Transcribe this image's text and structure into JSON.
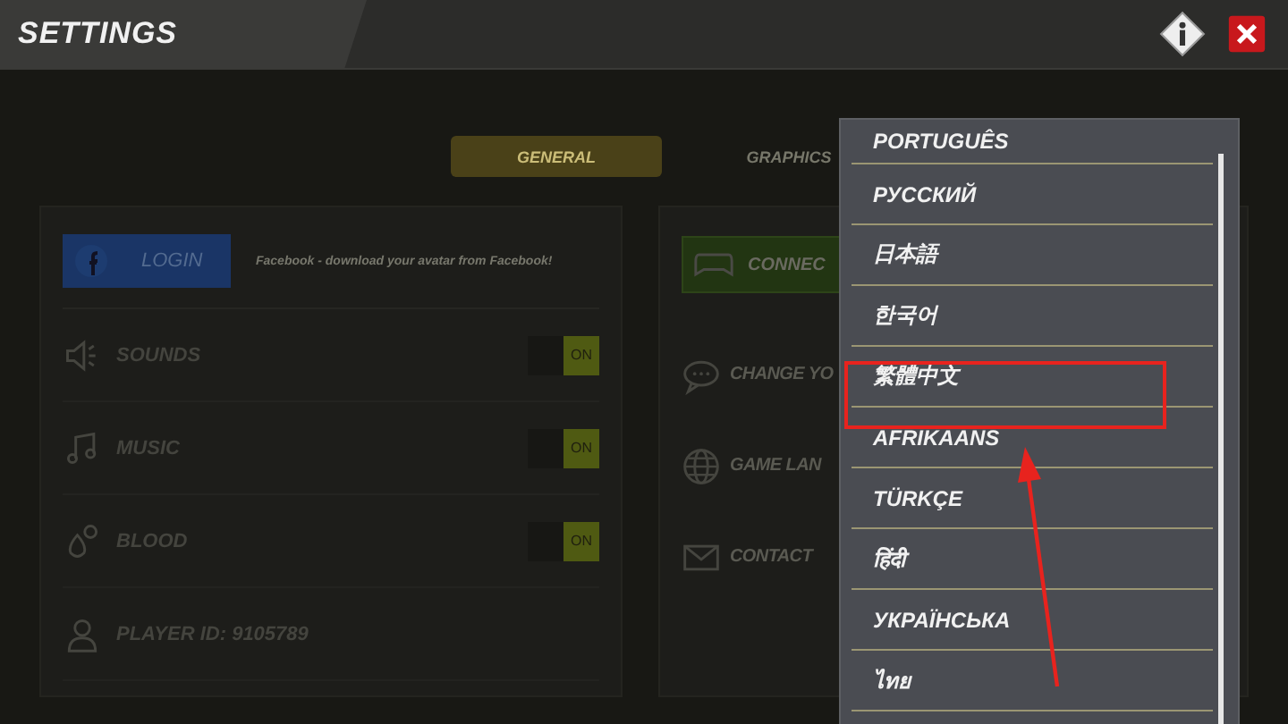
{
  "window": {
    "title": "SETTINGS"
  },
  "tabs": [
    {
      "label": "GENERAL",
      "selected": true
    },
    {
      "label": "GRAPHICS",
      "selected": false
    }
  ],
  "login": {
    "button": "LOGIN",
    "caption": "Facebook - download your avatar from Facebook!"
  },
  "settings": [
    {
      "kind": "toggle",
      "label": "SOUNDS",
      "toggle": "ON",
      "on": true
    },
    {
      "kind": "toggle",
      "label": "MUSIC",
      "toggle": "ON",
      "on": true
    },
    {
      "kind": "toggle",
      "label": "BLOOD",
      "toggle": "ON",
      "on": true
    },
    {
      "kind": "info",
      "label": "PLAYER ID: 9105789"
    }
  ],
  "right_panel": {
    "connect_button": "CONNEC",
    "items": [
      {
        "label": "CHANGE YO"
      },
      {
        "label": "GAME LAN"
      },
      {
        "label": "CONTACT"
      }
    ]
  },
  "language_menu": [
    {
      "label": "PORTUGUÊS",
      "highlighted": false
    },
    {
      "label": "РУССКИЙ",
      "highlighted": false
    },
    {
      "label": "日本語",
      "highlighted": false
    },
    {
      "label": "한국어",
      "highlighted": false
    },
    {
      "label": "繁體中文",
      "highlighted": true
    },
    {
      "label": "AFRIKAANS",
      "highlighted": false
    },
    {
      "label": "TÜRKÇE",
      "highlighted": false
    },
    {
      "label": "हिंदी",
      "highlighted": false
    },
    {
      "label": "УКРАЇНСЬКА",
      "highlighted": false
    },
    {
      "label": "ไทย",
      "highlighted": false
    }
  ]
}
